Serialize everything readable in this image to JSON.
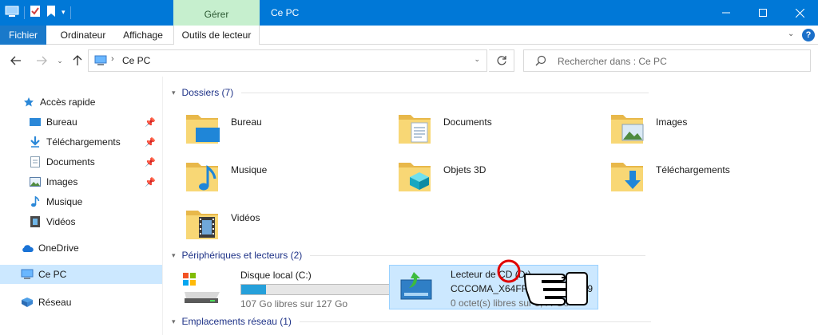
{
  "window": {
    "title": "Ce PC",
    "context_tab": "Gérer"
  },
  "ribbon": {
    "tabs": [
      "Fichier",
      "Ordinateur",
      "Affichage",
      "Outils de lecteur"
    ]
  },
  "address": {
    "path": "Ce PC"
  },
  "search": {
    "placeholder": "Rechercher dans : Ce PC"
  },
  "nav": {
    "quick_access": "Accès rapide",
    "items": [
      "Bureau",
      "Téléchargements",
      "Documents",
      "Images",
      "Musique",
      "Vidéos"
    ],
    "onedrive": "OneDrive",
    "this_pc": "Ce PC",
    "network": "Réseau"
  },
  "groups": {
    "folders": {
      "title": "Dossiers (7)",
      "items": [
        "Bureau",
        "Documents",
        "Images",
        "Musique",
        "Objets 3D",
        "Téléchargements",
        "Vidéos"
      ]
    },
    "devices": {
      "title": "Périphériques et lecteurs (2)"
    },
    "network": {
      "title": "Emplacements réseau (1)"
    }
  },
  "drives": [
    {
      "name": "Disque local (C:)",
      "free": "107 Go libres sur 127 Go",
      "used_fraction": 0.16
    },
    {
      "name": "Lecteur de CD (D:)",
      "label": "CCCOMA_X64FRE_FR-FR_DV9",
      "free": "0 octet(s) libres sur 5,44 Go"
    }
  ],
  "colors": {
    "accent": "#0078d7",
    "context_tab": "#c6efce",
    "selection": "#cce8ff",
    "annotation": "#e00000"
  }
}
